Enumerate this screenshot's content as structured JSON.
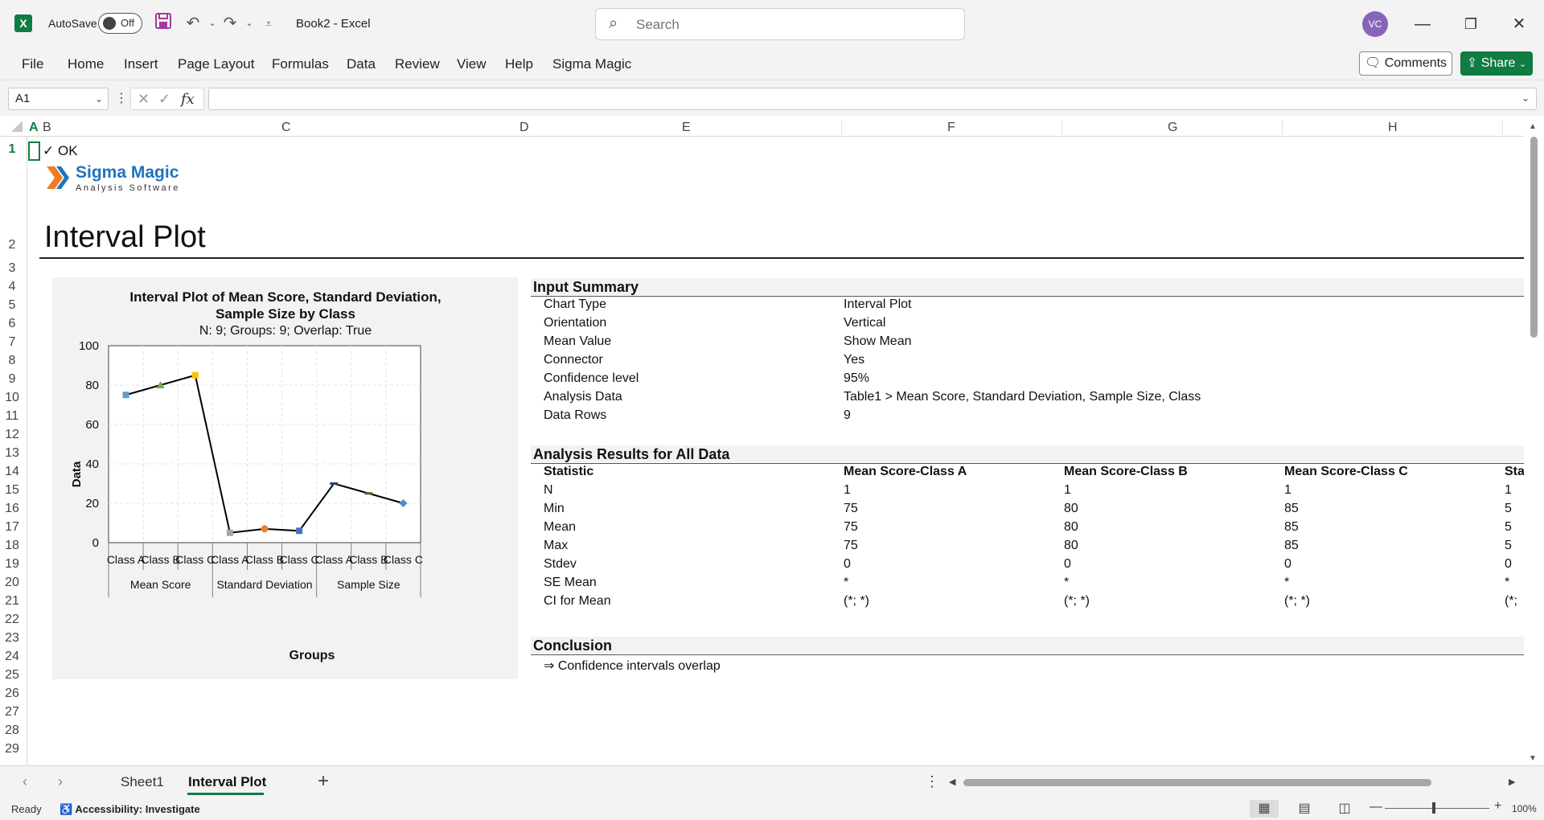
{
  "titlebar": {
    "autosave_label": "AutoSave",
    "autosave_state": "Off",
    "doc_title": "Book2  -  Excel",
    "search_placeholder": "Search",
    "avatar_initials": "VC"
  },
  "ribbon": {
    "tabs": [
      "File",
      "Home",
      "Insert",
      "Page Layout",
      "Formulas",
      "Data",
      "Review",
      "View",
      "Help",
      "Sigma Magic"
    ],
    "comments_label": "Comments",
    "share_label": "Share"
  },
  "formula_bar": {
    "name_box": "A1",
    "fx": "fx",
    "formula": ""
  },
  "columns": [
    "A",
    "B",
    "C",
    "D",
    "E",
    "F",
    "G",
    "H"
  ],
  "rows": [
    "1",
    "2",
    "3",
    "4",
    "5",
    "6",
    "7",
    "8",
    "9",
    "10",
    "11",
    "12",
    "13",
    "14",
    "15",
    "16",
    "17",
    "18",
    "19",
    "20",
    "21",
    "22",
    "23",
    "24",
    "25",
    "26",
    "27",
    "28",
    "29"
  ],
  "sheet": {
    "ok_text": "✓ OK",
    "logo_name": "Sigma Magic",
    "logo_sub": "Analysis Software",
    "page_title": "Interval Plot"
  },
  "chart_data": {
    "type": "line",
    "title": "Interval Plot of Mean Score, Standard Deviation, Sample Size by Class",
    "title_line1": "Interval Plot of Mean Score, Standard Deviation,",
    "title_line2": "Sample Size by Class",
    "subtitle": "N: 9; Groups: 9; Overlap: True",
    "ylabel": "Data",
    "xlabel": "Groups",
    "ylim": [
      0,
      100
    ],
    "yticks": [
      0,
      20,
      40,
      60,
      80,
      100
    ],
    "categories": [
      "Class A",
      "Class B",
      "Class C",
      "Class A",
      "Class B",
      "Class C",
      "Class A",
      "Class B",
      "Class C"
    ],
    "groups": [
      "Mean Score",
      "Standard Deviation",
      "Sample Size"
    ],
    "values": [
      75,
      80,
      85,
      5,
      7,
      6,
      30,
      25,
      20
    ],
    "marker_colors": [
      "#5b9bd5",
      "#70ad47",
      "#ffc000",
      "#a5a5a5",
      "#ed7d31",
      "#4472c4",
      "#264478",
      "#43682b",
      "#4e8ad0"
    ],
    "grid": true
  },
  "input_summary": {
    "heading": "Input Summary",
    "rows": [
      {
        "label": "Chart Type",
        "value": "Interval Plot"
      },
      {
        "label": "Orientation",
        "value": "Vertical"
      },
      {
        "label": "Mean Value",
        "value": "Show Mean"
      },
      {
        "label": "Connector",
        "value": "Yes"
      },
      {
        "label": "Confidence level",
        "value": "95%"
      },
      {
        "label": "Analysis Data",
        "value": "Table1 > Mean Score, Standard Deviation, Sample Size, Class"
      },
      {
        "label": "Data Rows",
        "value": "9"
      }
    ]
  },
  "results": {
    "heading": "Analysis Results for All Data",
    "headers": [
      "Statistic",
      "Mean Score-Class A",
      "Mean Score-Class B",
      "Mean Score-Class C",
      "Sta"
    ],
    "rows": [
      [
        "N",
        "1",
        "1",
        "1",
        "1"
      ],
      [
        "Min",
        "75",
        "80",
        "85",
        "5"
      ],
      [
        "Mean",
        "75",
        "80",
        "85",
        "5"
      ],
      [
        "Max",
        "75",
        "80",
        "85",
        "5"
      ],
      [
        "Stdev",
        "0",
        "0",
        "0",
        "0"
      ],
      [
        "SE Mean",
        "*",
        "*",
        "*",
        "*"
      ],
      [
        "CI for Mean",
        "(*; *)",
        "(*; *)",
        "(*; *)",
        "(*;"
      ]
    ]
  },
  "conclusion": {
    "heading": "Conclusion",
    "text": "⇒ Confidence intervals overlap"
  },
  "sheet_tabs": {
    "tabs": [
      "Sheet1",
      "Interval Plot"
    ],
    "active": "Interval Plot",
    "add": "+"
  },
  "status": {
    "ready": "Ready",
    "accessibility": "Accessibility: Investigate",
    "zoom": "100%"
  },
  "colors": {
    "excel_green": "#107c41",
    "avatar": "#8764b8",
    "logo_blue": "#1e73be",
    "logo_orange": "#f07b22"
  }
}
